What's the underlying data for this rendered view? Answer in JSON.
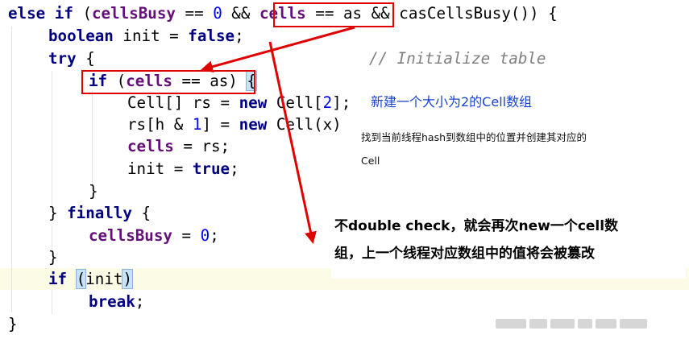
{
  "code": {
    "line1": {
      "kw_else": "else",
      "kw_if": "if",
      "open_paren": " (",
      "f_cellsBusy": "cellsBusy",
      "op1": " == ",
      "zero": "0",
      "op_and1": " && ",
      "f_cells": "cells",
      "eq_as": " == as",
      "op_and2": " && ",
      "call": "casCellsBusy()) {"
    },
    "line2": {
      "kw_boolean": "boolean",
      "mid": " init = ",
      "kw_false": "false",
      "end": ";"
    },
    "line3": {
      "kw_try": "try",
      "brace": " {",
      "comment": "// Initialize table"
    },
    "line4": {
      "kw_if": "if",
      "open": " (",
      "f_cells": "cells",
      "rest": " == as)",
      "space": " ",
      "brace": "{"
    },
    "line5": {
      "pre": "Cell[] rs = ",
      "kw_new": "new",
      "post": " Cell[",
      "num": "2",
      "end": "];"
    },
    "line6": {
      "pre": "rs[h & ",
      "num": "1",
      "mid": "] = ",
      "kw_new": "new",
      "post": " Cell(x)"
    },
    "line7": {
      "f_cells": "cells",
      "post": " = rs;"
    },
    "line8": {
      "pre": "init = ",
      "kw_true": "true",
      "end": ";"
    },
    "line9": {
      "brace": "}"
    },
    "line10": {
      "pre": "} ",
      "kw_finally": "finally",
      "post": " {"
    },
    "line11": {
      "f_cellsBusy": "cellsBusy",
      "mid": " = ",
      "num": "0",
      "end": ";"
    },
    "line12": {
      "brace": "}"
    },
    "line13": {
      "kw_if": "if",
      "space": " ",
      "paren_open": "(",
      "mid": "init",
      "paren_close": ")"
    },
    "line14": {
      "kw_break": "break",
      "end": ";"
    },
    "line15": {
      "brace": "}"
    }
  },
  "annotations": {
    "new_array_note": "新建一个大小为2的Cell数组",
    "find_position_note_line1": "找到当前线程hash到数组中的位置并创建其对应的",
    "find_position_note_line2": "Cell",
    "double_check_line1": "不double check，就会再次new一个cell数",
    "double_check_line2": "组，上一个线程对应数组中的值将会被篡改"
  },
  "colors": {
    "keyword": "#000080",
    "number": "#0000ff",
    "field": "#660e7a",
    "comment": "#808080",
    "annotation_blue": "#1a44cc",
    "highlight_box": "#e00000",
    "arrow": "#e00000",
    "current_line": "#fbfbe6"
  }
}
